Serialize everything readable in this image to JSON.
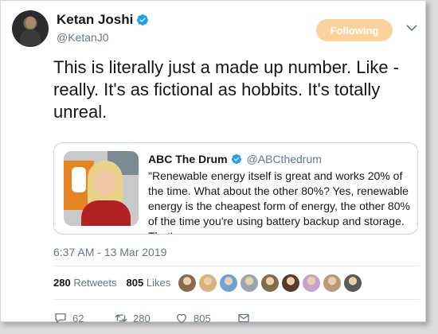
{
  "author": {
    "name": "Ketan Joshi",
    "handle": "@KetanJ0",
    "verified": true
  },
  "follow_button": {
    "label": "Following",
    "color": "#fbd29b"
  },
  "tweet": {
    "text": "This is literally just a made up number. Like - really. It's as fictional as hobbits. It's totally unreal."
  },
  "quoted_tweet": {
    "name": "ABC The Drum",
    "handle": "@ABCthedrum",
    "verified": true,
    "text": "\"Renewable energy itself is great and works 20% of the time. What about the other 80%? Yes, renewable energy is the cheapest form of energy, the other 80% of the time you're using battery backup and storage. That's..."
  },
  "timestamp": "6:37 AM - 13 Mar 2019",
  "stats": {
    "retweets_count": "280",
    "retweets_label": "Retweets",
    "likes_count": "805",
    "likes_label": "Likes"
  },
  "likers": [
    {
      "icon": "avatar-1",
      "color": "#8a6a4a"
    },
    {
      "icon": "avatar-2",
      "color": "#d8b27a"
    },
    {
      "icon": "avatar-3",
      "color": "#6aa3d8"
    },
    {
      "icon": "avatar-4",
      "color": "#9aa5ad"
    },
    {
      "icon": "avatar-5",
      "color": "#7d6d4a"
    },
    {
      "icon": "avatar-6",
      "color": "#5c3a2a"
    },
    {
      "icon": "avatar-7",
      "color": "#c9a3c9"
    },
    {
      "icon": "avatar-8",
      "color": "#b89a7a"
    },
    {
      "icon": "avatar-9",
      "color": "#5a5a5a"
    }
  ],
  "actions": {
    "reply_count": "62",
    "retweet_count": "280",
    "like_count": "805"
  },
  "colors": {
    "verified_blue": "#1da1f2",
    "secondary_text": "#657786",
    "primary_text": "#14171a"
  }
}
